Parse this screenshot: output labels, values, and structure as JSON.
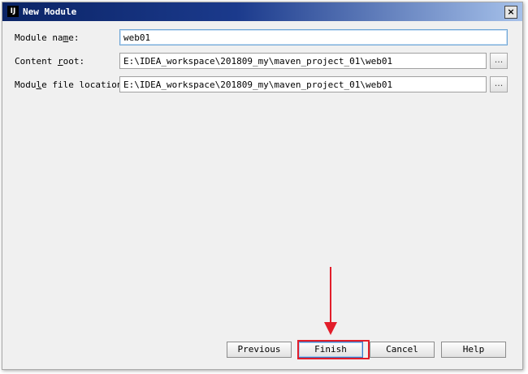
{
  "window": {
    "title": "New Module",
    "app_icon_text": "IJ",
    "close_symbol": "×"
  },
  "form": {
    "module_name": {
      "label_before": "Module na",
      "label_mnemonic": "m",
      "label_after": "e:",
      "value": "web01"
    },
    "content_root": {
      "label_before": "Content ",
      "label_mnemonic": "r",
      "label_after": "oot:",
      "value": "E:\\IDEA_workspace\\201809_my\\maven_project_01\\web01"
    },
    "module_file_location": {
      "label_before": "Modu",
      "label_mnemonic": "l",
      "label_after": "e file location:",
      "value": "E:\\IDEA_workspace\\201809_my\\maven_project_01\\web01"
    },
    "browse_label": "..."
  },
  "buttons": {
    "previous": "Previous",
    "finish": "Finish",
    "cancel": "Cancel",
    "help": "Help"
  },
  "annotation": {
    "color": "#e21d2a"
  }
}
